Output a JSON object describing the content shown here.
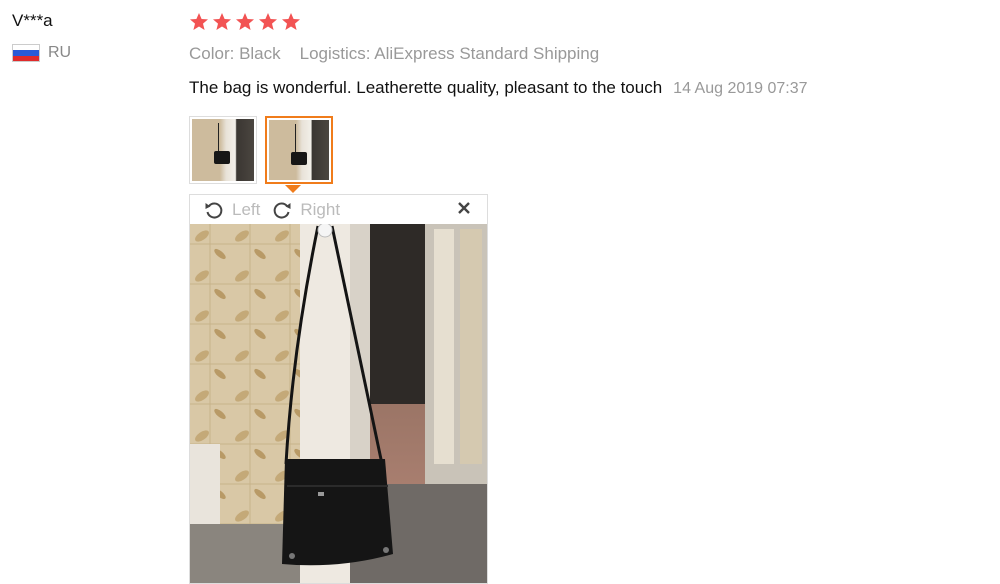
{
  "reviewer": {
    "name": "V***a",
    "country": "RU",
    "flag_colors": [
      "#ffffff",
      "#2a5bd7",
      "#e02b2b"
    ]
  },
  "review": {
    "rating": 5,
    "star_color": "#f25353",
    "color_label": "Color: Black",
    "logistics_label": "Logistics: AliExpress Standard Shipping",
    "text": "The bag is wonderful. Leatherette quality, pleasant to the touch",
    "timestamp": "14 Aug 2019 07:37"
  },
  "thumbnails": [
    {
      "selected": false
    },
    {
      "selected": true
    }
  ],
  "viewer": {
    "rotate_left_label": "Left",
    "rotate_right_label": "Right",
    "accent_color": "#f07c1b"
  }
}
